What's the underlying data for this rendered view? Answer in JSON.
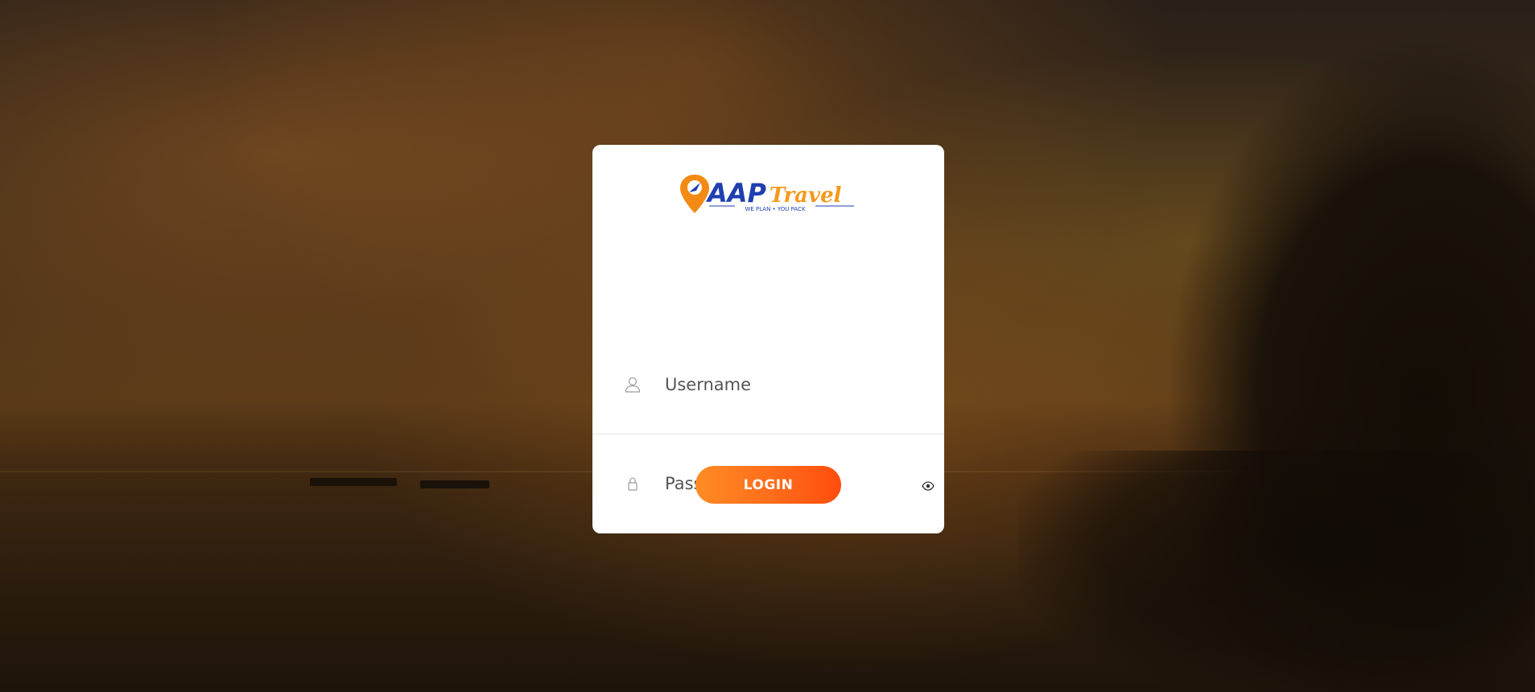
{
  "logo": {
    "brand_aap": "AAP",
    "brand_travel": "Travel",
    "tagline": "WE PLAN • YOU PACK",
    "colors": {
      "aap": "#1f3fb0",
      "travel": "#f39a1c",
      "pin": "#f28a14"
    }
  },
  "form": {
    "username": {
      "placeholder": "Username",
      "icon": "user-icon"
    },
    "password": {
      "placeholder": "Password",
      "icon": "lock-icon",
      "toggle_icon": "eye-icon"
    },
    "login_label": "LOGIN",
    "login_colors": [
      "#ff8c25",
      "#ff4d0d"
    ]
  }
}
